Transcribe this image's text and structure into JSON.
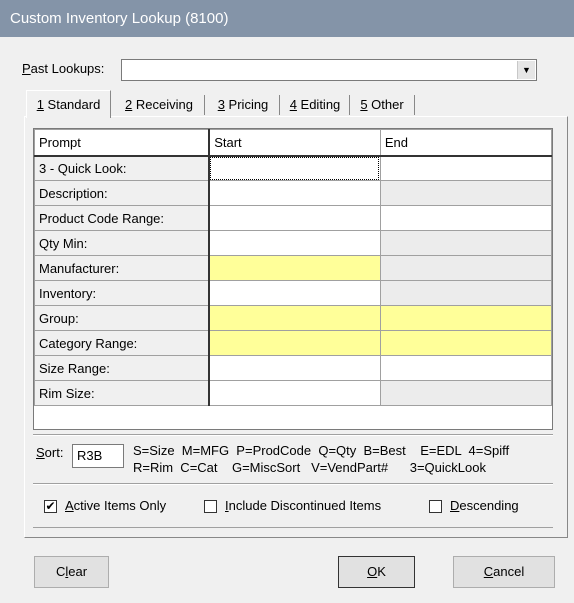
{
  "window": {
    "title": "Custom Inventory Lookup (8100)"
  },
  "past_lookups": {
    "label_key": "P",
    "label_rest": "ast Lookups:",
    "value": "",
    "dropdown_icon": "chevron-down-icon"
  },
  "tabs": [
    {
      "key": "1",
      "label": " Standard"
    },
    {
      "key": "2",
      "label": " Receiving"
    },
    {
      "key": "3",
      "label": " Pricing"
    },
    {
      "key": "4",
      "label": " Editing"
    },
    {
      "key": "5",
      "label": " Other"
    }
  ],
  "grid": {
    "headers": [
      "Prompt",
      "Start",
      "End"
    ],
    "rows": [
      {
        "prompt": "3 - Quick Look:",
        "start": "",
        "end": ""
      },
      {
        "prompt": "Description:",
        "start": "",
        "end": ""
      },
      {
        "prompt": "Product Code Range:",
        "start": "",
        "end": ""
      },
      {
        "prompt": "Qty Min:",
        "start": "",
        "end": ""
      },
      {
        "prompt": "Manufacturer:",
        "start": "",
        "end": ""
      },
      {
        "prompt": "Inventory:",
        "start": "",
        "end": ""
      },
      {
        "prompt": "Group:",
        "start": "",
        "end": ""
      },
      {
        "prompt": "Category Range:",
        "start": "",
        "end": ""
      },
      {
        "prompt": "Size Range:",
        "start": "",
        "end": ""
      },
      {
        "prompt": "Rim Size:",
        "start": "",
        "end": ""
      }
    ]
  },
  "sort": {
    "label_key": "S",
    "label_rest": "ort:",
    "value": "R3B",
    "legend_line1": "S=Size  M=MFG  P=ProdCode  Q=Qty  B=Best    E=EDL  4=Spiff",
    "legend_line2": "R=Rim  C=Cat    G=MiscSort   V=VendPart#      3=QuickLook"
  },
  "options": {
    "active_only": {
      "key": "A",
      "rest": "ctive Items Only",
      "checked": true
    },
    "include_discontinued": {
      "key": "I",
      "rest": "nclude Discontinued Items",
      "checked": false
    },
    "descending": {
      "key": "D",
      "rest": "escending",
      "checked": false
    }
  },
  "buttons": {
    "clear": {
      "pre": "C",
      "key": "l",
      "rest": "ear"
    },
    "ok": {
      "pre": "",
      "key": "O",
      "rest": "K"
    },
    "cancel": {
      "pre": "",
      "key": "C",
      "rest": "ancel"
    }
  },
  "colors": {
    "title_bar": "#8494a8",
    "required_field": "#ffff99",
    "window_bg": "#f0f0f0"
  }
}
